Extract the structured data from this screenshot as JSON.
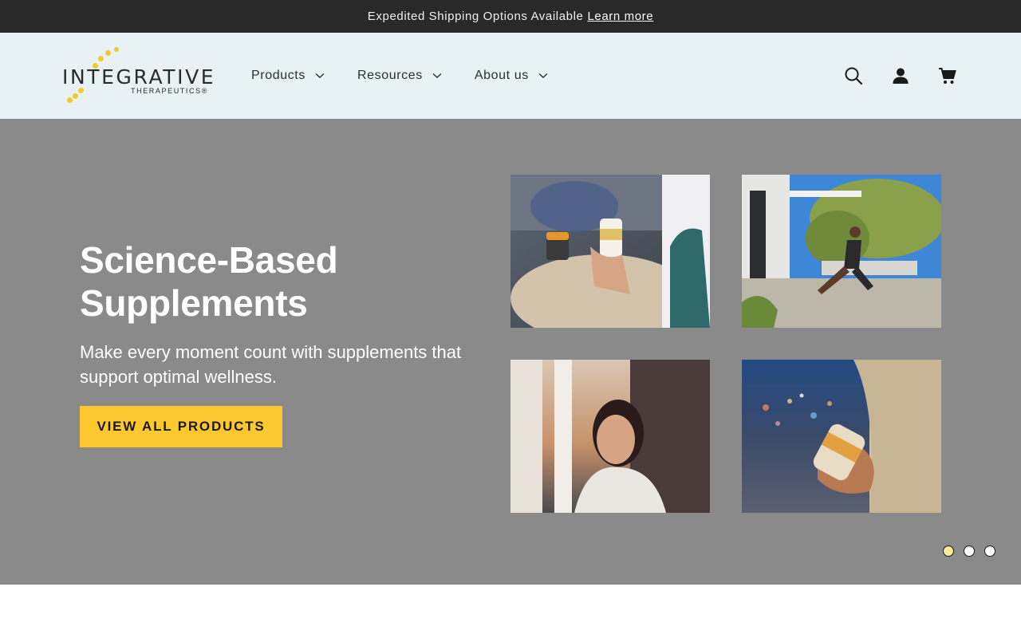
{
  "announcement": {
    "text": "Expedited Shipping Options Available",
    "link": "Learn more"
  },
  "logo": {
    "word": "INTEGRATIVE",
    "sub": "THERAPEUTICS®",
    "accent": "#f5c82e"
  },
  "nav": {
    "items": [
      {
        "label": "Products"
      },
      {
        "label": "Resources"
      },
      {
        "label": "About us"
      }
    ]
  },
  "icons": {
    "search": "search-icon",
    "account": "account-icon",
    "cart": "cart-icon",
    "chevron": "chevron-down-icon"
  },
  "hero": {
    "title": "Science-Based Supplements",
    "subtitle": "Make every moment count with supplements that support optimal wellness.",
    "cta": "VIEW ALL PRODUCTS",
    "background": "#8a8a8a",
    "cta_color": "#fdc72f"
  },
  "slider": {
    "count": 3,
    "active": 1
  }
}
